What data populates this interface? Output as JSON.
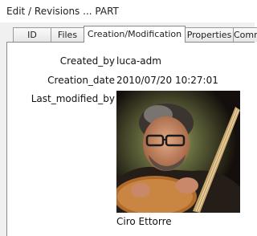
{
  "window": {
    "title": "Edit / Revisions ... PART"
  },
  "tabs": [
    {
      "label": "ID"
    },
    {
      "label": "Files"
    },
    {
      "label": "Creation/Modification"
    },
    {
      "label": "Properties"
    },
    {
      "label": "Comme"
    }
  ],
  "fields": {
    "created_by_label": "Created_by",
    "created_by_value": "luca-adm",
    "creation_date_label": "Creation_date",
    "creation_date_value": "2010/07/20 10:27:01",
    "last_modified_by_label": "Last_modified_by",
    "last_modified_by_caption": "Ciro Ettorre"
  }
}
